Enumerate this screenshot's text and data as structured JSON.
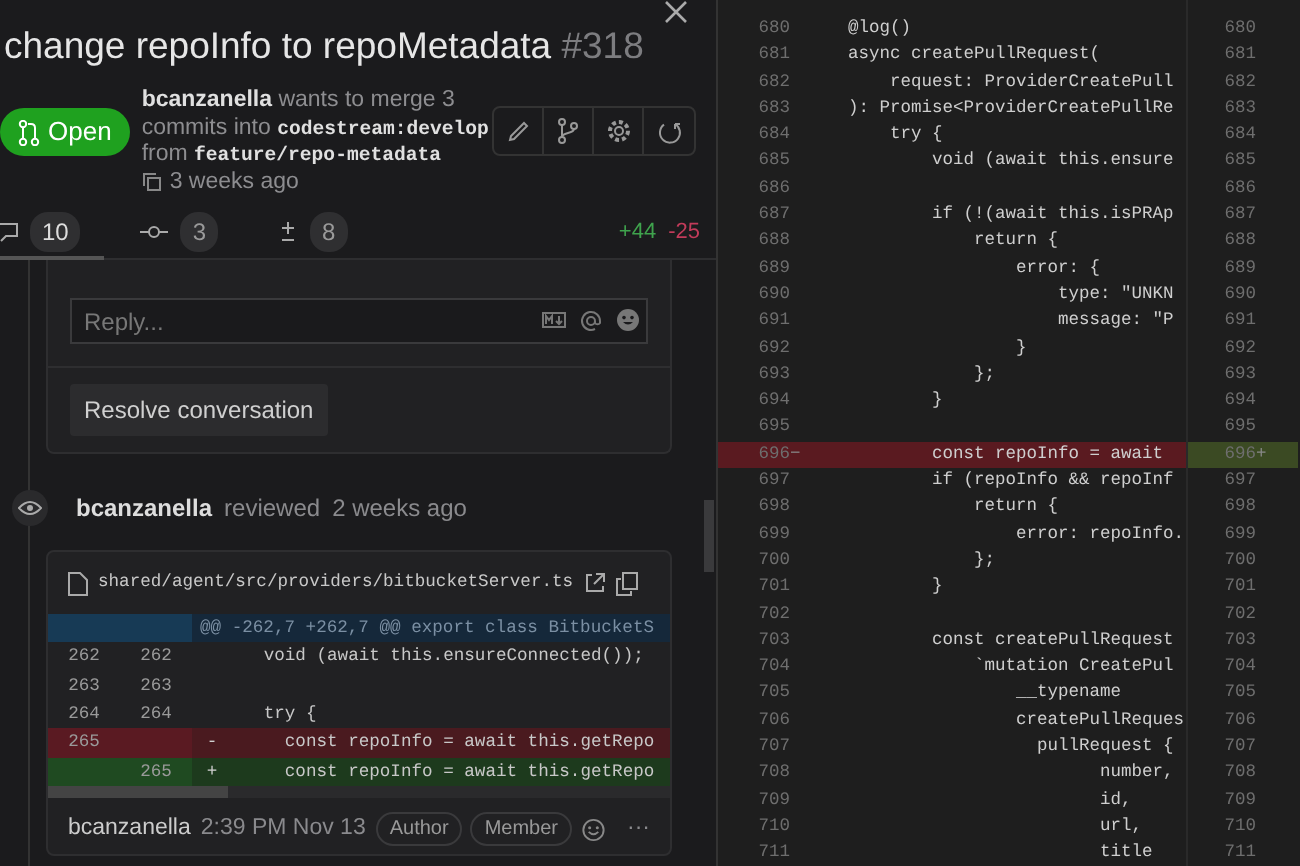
{
  "pull_request": {
    "title": "change repoInfo to repoMetadata",
    "number": "#318",
    "state": {
      "label": "Open",
      "kind": "open"
    },
    "description": "**bcanzanella** wants to merge 3 commits into **codestream:develop** from **feature/repo-metadata**",
    "age": "3 weeks ago"
  },
  "tabs": [
    {
      "kind": "comments",
      "count": "10",
      "selected": true
    },
    {
      "kind": "commits",
      "count": "3",
      "selected": false
    },
    {
      "kind": "files",
      "count": "8",
      "selected": false
    }
  ],
  "diff_stats": {
    "added": "+44",
    "removed": "-25"
  },
  "thread": {
    "reply": {
      "placeholder": "Reply..."
    },
    "resolve_button": "Resolve conversation"
  },
  "review": {
    "author": "bcanzanella",
    "action": "reviewed",
    "age": "2 weeks ago"
  },
  "file": {
    "path": "shared/agent/src/providers/bitbucketServer.ts",
    "hunk": "@@ -262,7 +262,7 @@ export class BitbucketS",
    "rows": [
      {
        "old": "262",
        "new": "262",
        "code": "   void (await this.ensureConnected());",
        "kind": "context"
      },
      {
        "old": "263",
        "new": "263",
        "kind": "context"
      },
      {
        "old": "264",
        "new": "264",
        "code": "   try {",
        "kind": "context"
      },
      {
        "old": "265",
        "sign": "-",
        "code": "     const repoInfo = await this.getRepo",
        "kind": "removed"
      },
      {
        "new": "265",
        "sign": "+",
        "code": "     const repoInfo = await this.getRepo",
        "kind": "added"
      }
    ]
  },
  "comment": {
    "author": "bcanzanella",
    "time": "2:39 PM Nov 13",
    "badges": [
      "Author",
      "Member"
    ],
    "more": "···"
  },
  "editor": {
    "lines": [
      {
        "number": "680",
        "code": "    @log()",
        "kind": "normal"
      },
      {
        "number": "681",
        "code": "    async createPullRequest(",
        "kind": "normal"
      },
      {
        "number": "682",
        "code": "        request: ProviderCreatePull",
        "kind": "normal"
      },
      {
        "number": "683",
        "code": "    ): Promise<ProviderCreatePullRe",
        "kind": "normal"
      },
      {
        "number": "684",
        "code": "        try {",
        "kind": "normal"
      },
      {
        "number": "685",
        "code": "            void (await this.ensure",
        "kind": "normal"
      },
      {
        "number": "686",
        "kind": "normal"
      },
      {
        "number": "687",
        "code": "            if (!(await this.isPRAp",
        "kind": "normal"
      },
      {
        "number": "688",
        "code": "                return {",
        "kind": "normal"
      },
      {
        "number": "689",
        "code": "                    error: {",
        "kind": "normal"
      },
      {
        "number": "690",
        "code": "                        type: \"UNKN",
        "kind": "normal"
      },
      {
        "number": "691",
        "code": "                        message: \"P",
        "kind": "normal"
      },
      {
        "number": "692",
        "code": "                    }",
        "kind": "normal"
      },
      {
        "number": "693",
        "code": "                };",
        "kind": "normal"
      },
      {
        "number": "694",
        "code": "            }",
        "kind": "normal"
      },
      {
        "number": "695",
        "kind": "normal"
      },
      {
        "number": "696",
        "marker": "−",
        "code": "            const repoInfo = await",
        "kind": "removed"
      },
      {
        "number": "697",
        "code": "            if (repoInfo && repoInf",
        "kind": "normal"
      },
      {
        "number": "698",
        "code": "                return {",
        "kind": "normal"
      },
      {
        "number": "699",
        "code": "                    error: repoInfo.",
        "kind": "normal"
      },
      {
        "number": "700",
        "code": "                };",
        "kind": "normal"
      },
      {
        "number": "701",
        "code": "            }",
        "kind": "normal"
      },
      {
        "number": "702",
        "kind": "normal"
      },
      {
        "number": "703",
        "code": "            const createPullRequest",
        "kind": "normal"
      },
      {
        "number": "704",
        "code": "                `mutation CreatePul",
        "kind": "normal"
      },
      {
        "number": "705",
        "code": "                    __typename",
        "kind": "normal"
      },
      {
        "number": "706",
        "code": "                    createPullReques",
        "kind": "normal"
      },
      {
        "number": "707",
        "code": "                      pullRequest {",
        "kind": "normal"
      },
      {
        "number": "708",
        "code": "                            number,",
        "kind": "normal"
      },
      {
        "number": "709",
        "code": "                            id,",
        "kind": "normal"
      },
      {
        "number": "710",
        "code": "                            url,",
        "kind": "normal"
      },
      {
        "number": "711",
        "code": "                            title",
        "kind": "normal"
      }
    ],
    "right_gutter": [
      {
        "number": "680",
        "kind": "normal"
      },
      {
        "number": "681",
        "kind": "normal"
      },
      {
        "number": "682",
        "kind": "normal"
      },
      {
        "number": "683",
        "kind": "normal"
      },
      {
        "number": "684",
        "kind": "normal"
      },
      {
        "number": "685",
        "kind": "normal"
      },
      {
        "number": "686",
        "kind": "normal"
      },
      {
        "number": "687",
        "kind": "normal"
      },
      {
        "number": "688",
        "kind": "normal"
      },
      {
        "number": "689",
        "kind": "normal"
      },
      {
        "number": "690",
        "kind": "normal"
      },
      {
        "number": "691",
        "kind": "normal"
      },
      {
        "number": "692",
        "kind": "normal"
      },
      {
        "number": "693",
        "kind": "normal"
      },
      {
        "number": "694",
        "kind": "normal"
      },
      {
        "number": "695",
        "kind": "normal"
      },
      {
        "number": "696",
        "marker": "+",
        "kind": "added"
      },
      {
        "number": "697",
        "kind": "normal"
      },
      {
        "number": "698",
        "kind": "normal"
      },
      {
        "number": "699",
        "kind": "normal"
      },
      {
        "number": "700",
        "kind": "normal"
      },
      {
        "number": "701",
        "kind": "normal"
      },
      {
        "number": "702",
        "kind": "normal"
      },
      {
        "number": "703",
        "kind": "normal"
      },
      {
        "number": "704",
        "kind": "normal"
      },
      {
        "number": "705",
        "kind": "normal"
      },
      {
        "number": "706",
        "kind": "normal"
      },
      {
        "number": "707",
        "kind": "normal"
      },
      {
        "number": "708",
        "kind": "normal"
      },
      {
        "number": "709",
        "kind": "normal"
      },
      {
        "number": "710",
        "kind": "normal"
      },
      {
        "number": "711",
        "kind": "normal"
      }
    ]
  }
}
